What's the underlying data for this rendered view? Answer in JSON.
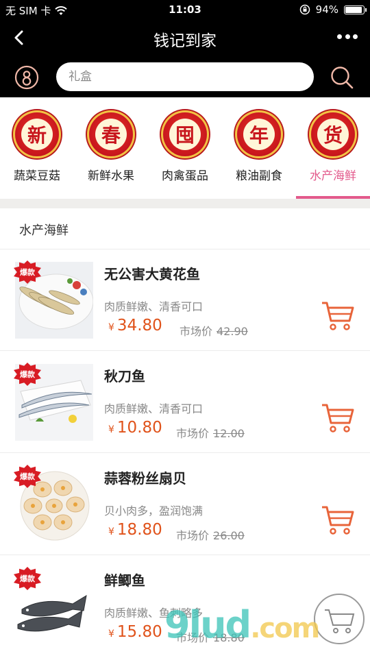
{
  "status": {
    "carrier": "无 SIM 卡",
    "time": "11:03",
    "battery": "94%",
    "battery_level": 0.94
  },
  "nav": {
    "title": "钱记到家"
  },
  "search": {
    "placeholder": "礼盒"
  },
  "categories": [
    {
      "label": "蔬菜豆菇",
      "badge": "新"
    },
    {
      "label": "新鲜水果",
      "badge": "春"
    },
    {
      "label": "肉禽蛋品",
      "badge": "囤"
    },
    {
      "label": "粮油副食",
      "badge": "年"
    },
    {
      "label": "水产海鲜",
      "badge": "货"
    }
  ],
  "active_category": 4,
  "section_title": "水产海鲜",
  "products": [
    {
      "hot": "爆款",
      "name": "无公害大黄花鱼",
      "desc": "肉质鲜嫩、清香可口",
      "currency": "¥",
      "price": "34.80",
      "market_label": "市场价",
      "market_price": "42.90"
    },
    {
      "hot": "爆款",
      "name": "秋刀鱼",
      "desc": "肉质鲜嫩、清香可口",
      "currency": "¥",
      "price": "10.80",
      "market_label": "市场价",
      "market_price": "12.00"
    },
    {
      "hot": "爆款",
      "name": "蒜蓉粉丝扇贝",
      "desc": "贝小肉多，盈润饱满",
      "currency": "¥",
      "price": "18.80",
      "market_label": "市场价",
      "market_price": "26.00"
    },
    {
      "hot": "爆款",
      "name": "鲜鲫鱼",
      "desc": "肉质鲜嫩、鱼刺略多",
      "currency": "¥",
      "price": "15.80",
      "market_label": "市场价",
      "market_price": "18.80"
    }
  ],
  "watermark": {
    "main": "9lud",
    "suffix": ".com"
  },
  "colors": {
    "accent": "#e35a8c",
    "price": "#e0531b",
    "cart": "#e8643a",
    "badge": "#c8161d"
  }
}
